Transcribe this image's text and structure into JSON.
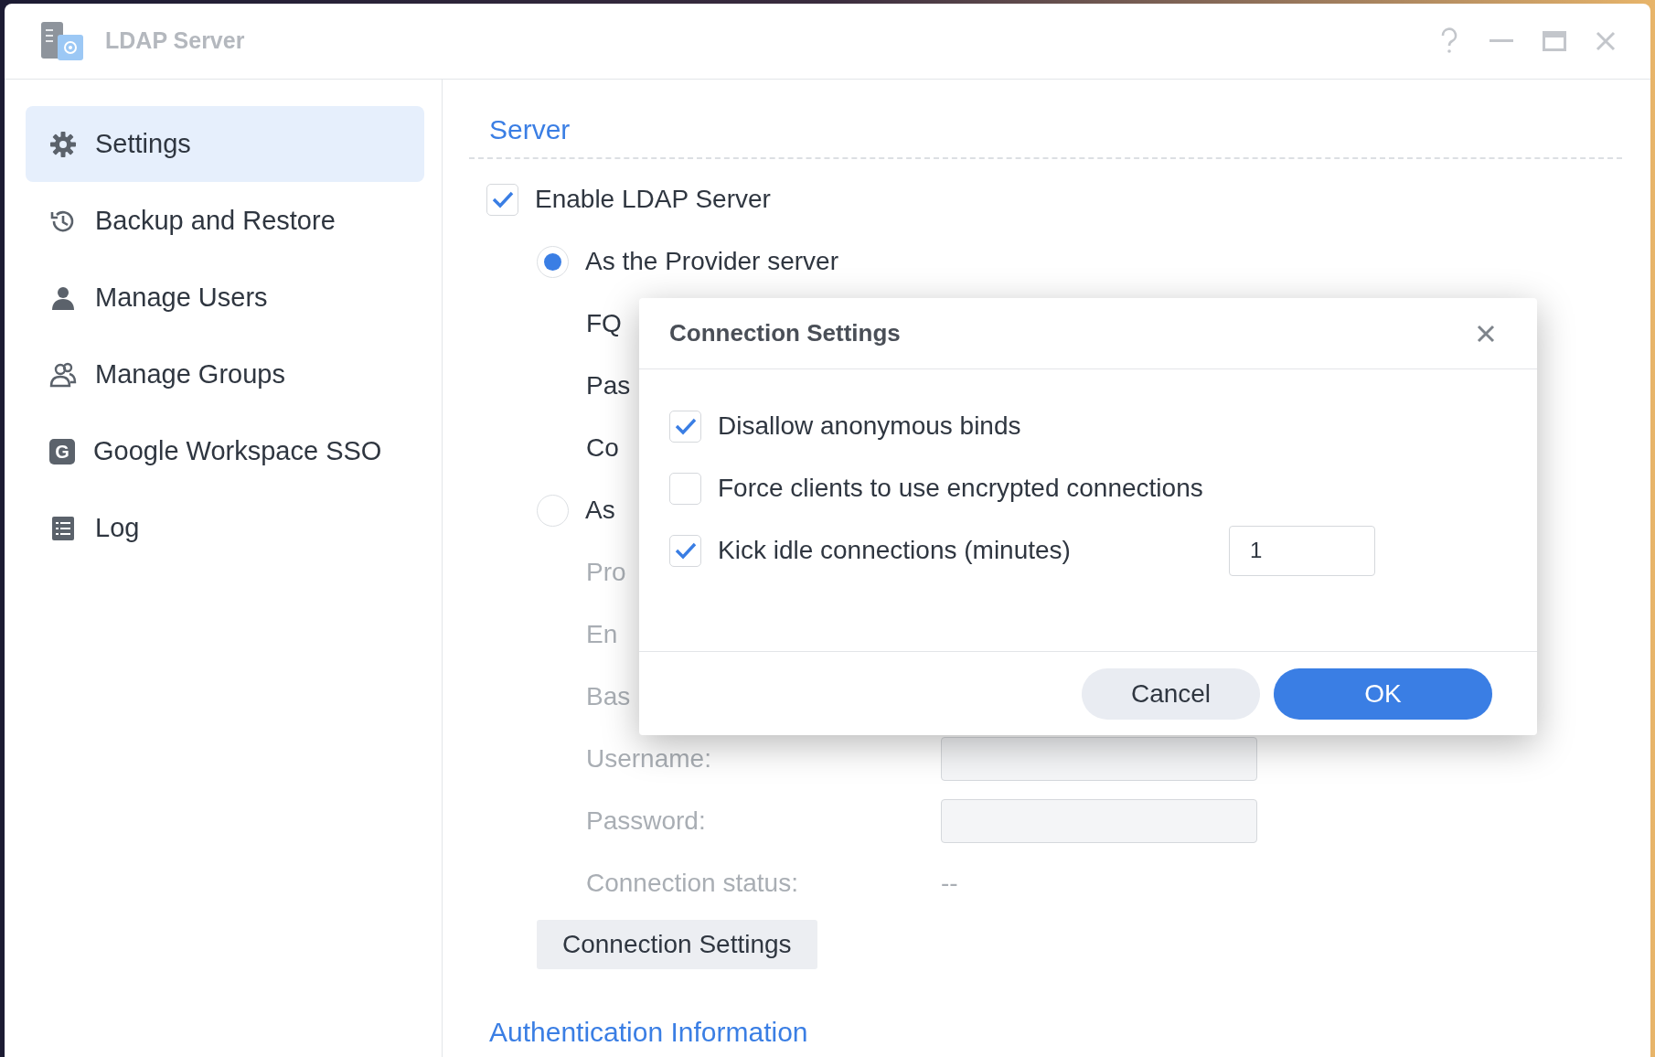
{
  "window": {
    "title": "LDAP Server"
  },
  "sidebar": {
    "items": [
      {
        "label": "Settings",
        "selected": true
      },
      {
        "label": "Backup and Restore",
        "selected": false
      },
      {
        "label": "Manage Users",
        "selected": false
      },
      {
        "label": "Manage Groups",
        "selected": false
      },
      {
        "label": "Google Workspace SSO",
        "icon_letter": "G",
        "selected": false
      },
      {
        "label": "Log",
        "selected": false
      }
    ]
  },
  "server": {
    "heading": "Server",
    "enable": {
      "label": "Enable LDAP Server",
      "checked": true
    },
    "modes": [
      {
        "label": "As the Provider server",
        "selected": true,
        "fields": [
          {
            "label": "FQ",
            "disabled": false
          },
          {
            "label": "Pas",
            "disabled": false
          },
          {
            "label": "Co",
            "disabled": false
          }
        ]
      },
      {
        "label": "As",
        "selected": false,
        "fields": [
          {
            "label": "Pro",
            "disabled": true
          },
          {
            "label": "En",
            "disabled": true
          },
          {
            "label": "Bas",
            "disabled": true
          },
          {
            "label": "Username:",
            "disabled": true,
            "kind": "field"
          },
          {
            "label": "Password:",
            "disabled": true,
            "kind": "field"
          },
          {
            "label": "Connection status:",
            "disabled": true,
            "kind": "value",
            "value": "--"
          }
        ]
      }
    ],
    "button": "Connection Settings"
  },
  "auth_heading": "Authentication Information",
  "dialog": {
    "title": "Connection Settings",
    "options": [
      {
        "label": "Disallow anonymous binds",
        "checked": true
      },
      {
        "label": "Force clients to use encrypted connections",
        "checked": false
      },
      {
        "label": "Kick idle connections (minutes)",
        "checked": true,
        "value": "1"
      }
    ],
    "buttons": [
      {
        "label": "Cancel",
        "kind": "secondary"
      },
      {
        "label": "OK",
        "kind": "primary"
      }
    ]
  }
}
